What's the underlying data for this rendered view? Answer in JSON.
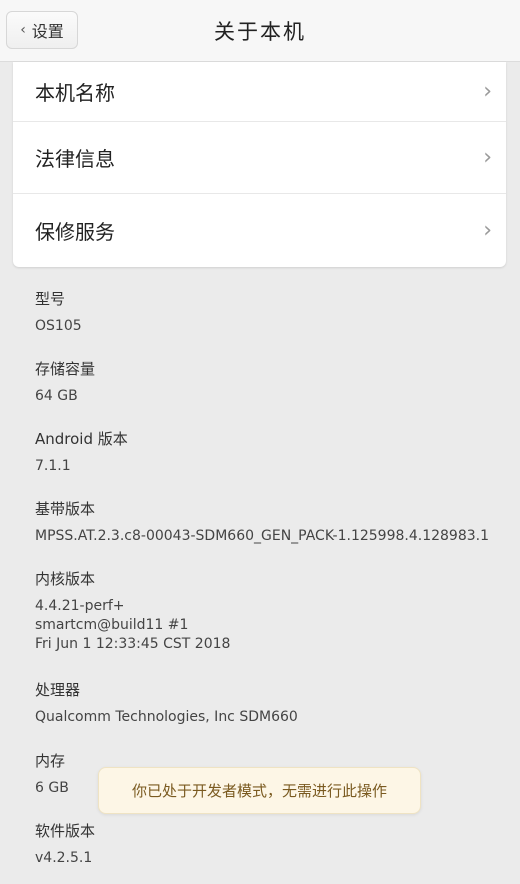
{
  "header": {
    "back_label": "设置",
    "title": "关于本机"
  },
  "menu": [
    {
      "label": "本机名称"
    },
    {
      "label": "法律信息"
    },
    {
      "label": "保修服务"
    }
  ],
  "info": [
    {
      "label": "型号",
      "value": "OS105"
    },
    {
      "label": "存储容量",
      "value": "64 GB"
    },
    {
      "label": "Android 版本",
      "value": "7.1.1"
    },
    {
      "label": "基带版本",
      "value": "MPSS.AT.2.3.c8-00043-SDM660_GEN_PACK-1.125998.4.128983.1"
    },
    {
      "label": "内核版本",
      "value_lines": [
        "4.4.21-perf+",
        "smartcm@build11 #1",
        "Fri Jun 1 12:33:45 CST 2018"
      ]
    },
    {
      "label": "处理器",
      "value": "Qualcomm Technologies, Inc SDM660"
    },
    {
      "label": "内存",
      "value": "6 GB"
    },
    {
      "label": "软件版本",
      "value": "v4.2.5.1"
    }
  ],
  "toast": {
    "message": "你已处于开发者模式，无需进行此操作"
  }
}
